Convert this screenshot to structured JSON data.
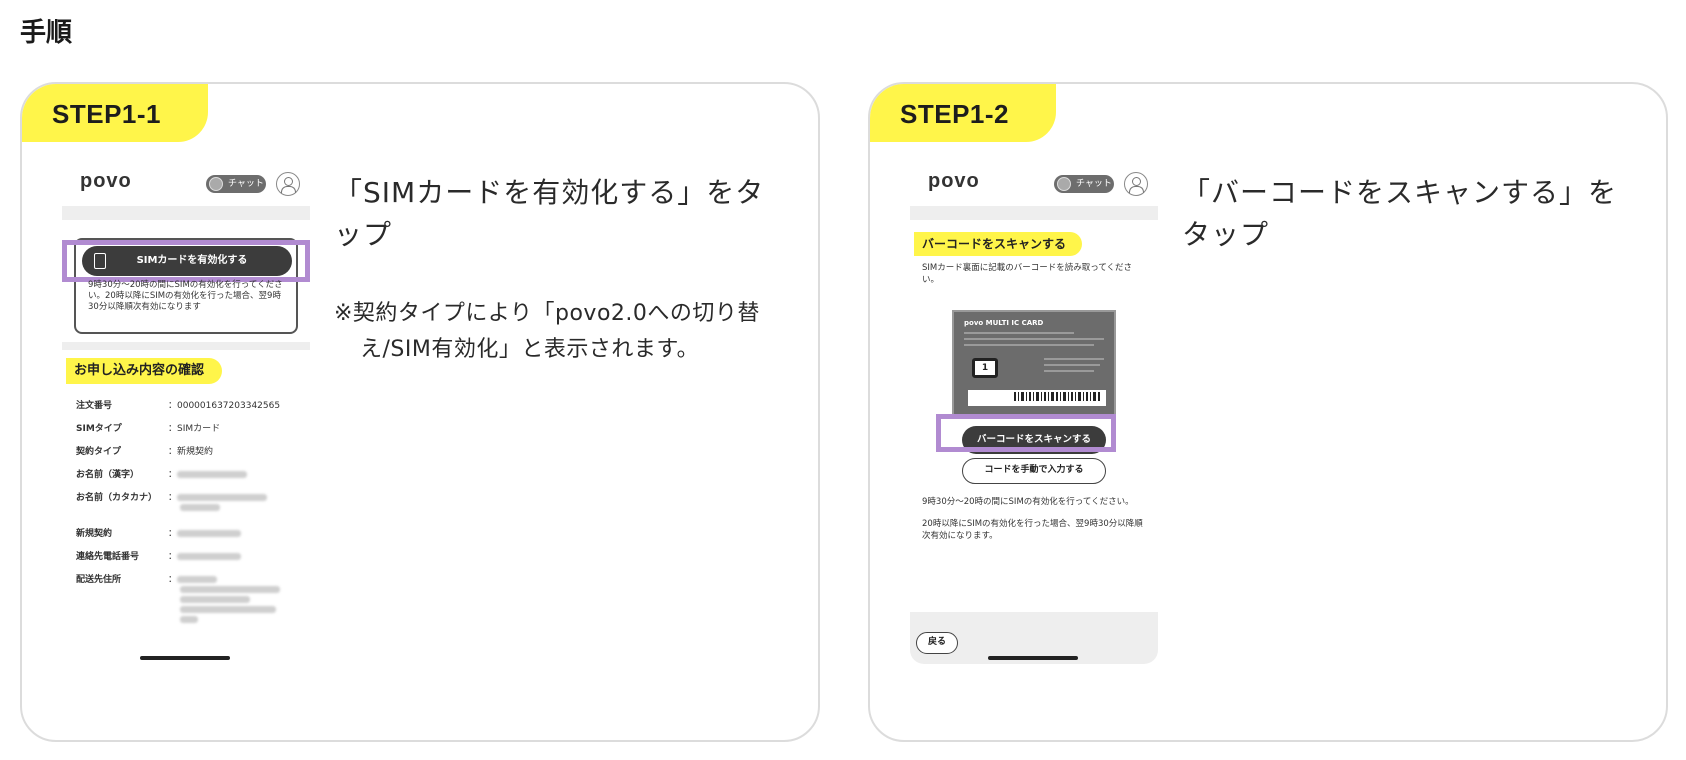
{
  "page": {
    "heading": "手順"
  },
  "steps": [
    {
      "tag": "STEP1-1",
      "description": "「SIMカードを有効化する」をタップ",
      "note": "※契約タイプにより「povo2.0への切り替え/SIM有効化」と表示されます。",
      "phone": {
        "logo": "povo",
        "chat_label": "チャット",
        "activate_button": "SIMカードを有効化する",
        "notice": "9時30分〜20時の間にSIMの有効化を行ってください。20時以降にSIMの有効化を行った場合、翌9時30分以降順次有効になります",
        "section_title": "お申し込み内容の確認",
        "rows": [
          {
            "key": "注文番号",
            "value": "：000001637203342565"
          },
          {
            "key": "SIMタイプ",
            "value": "：SIMカード"
          },
          {
            "key": "契約タイプ",
            "value": "：新規契約"
          },
          {
            "key": "お名前（漢字）",
            "value": "："
          },
          {
            "key": "お名前（カタカナ）",
            "value": "："
          },
          {
            "key": "新規契約",
            "value": "："
          },
          {
            "key": "連絡先電話番号",
            "value": "："
          },
          {
            "key": "配送先住所",
            "value": "："
          }
        ]
      }
    },
    {
      "tag": "STEP1-2",
      "description": "「バーコードをスキャンする」をタップ",
      "phone": {
        "logo": "povo",
        "chat_label": "チャット",
        "section_title": "バーコードをスキャンする",
        "instruction": "SIMカード裏面に記載のバーコードを読み取ってください。",
        "card_title": "povo MULTI IC CARD",
        "scan_button": "バーコードをスキャンする",
        "manual_button": "コードを手動で入力する",
        "footer_text_1": "9時30分〜20時の間にSIMの有効化を行ってください。",
        "footer_text_2": "20時以降にSIMの有効化を行った場合、翌9時30分以降順次有効になります。",
        "back_button": "戻る"
      }
    }
  ],
  "colors": {
    "accent_yellow": "#fff54a",
    "highlight_purple": "#b18bd1"
  }
}
